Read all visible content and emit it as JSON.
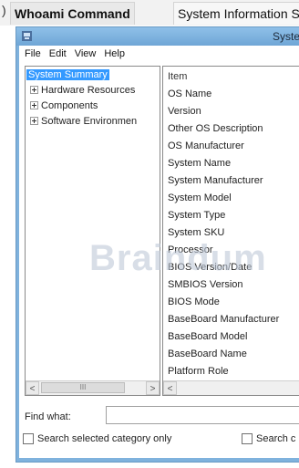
{
  "tabs": {
    "edge_glyph": ")",
    "active": "Whoami Command",
    "next": "System Information Se"
  },
  "window": {
    "title": "Syste",
    "menu": [
      "File",
      "Edit",
      "View",
      "Help"
    ]
  },
  "tree": {
    "items": [
      {
        "label": "System Summary",
        "selected": true
      },
      {
        "label": "Hardware Resources"
      },
      {
        "label": "Components"
      },
      {
        "label": "Software Environmen"
      }
    ],
    "scroll_thumb_glyph": "III"
  },
  "list": {
    "header": "Item",
    "rows": [
      "OS Name",
      "Version",
      "Other OS Description",
      "OS Manufacturer",
      "System Name",
      "System Manufacturer",
      "System Model",
      "System Type",
      "System SKU",
      "Processor",
      "BIOS Version/Date",
      "SMBIOS Version",
      "BIOS Mode",
      "BaseBoard Manufacturer",
      "BaseBoard Model",
      "BaseBoard Name",
      "Platform Role"
    ]
  },
  "find": {
    "label": "Find what:",
    "value": "",
    "search_selected": "Search selected category only",
    "search_cat": "Search c"
  },
  "watermark": "Braindum"
}
